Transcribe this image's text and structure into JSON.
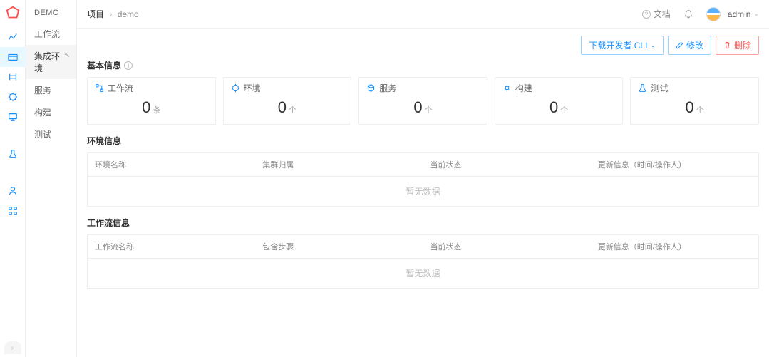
{
  "top": {
    "crumb_root": "项目",
    "crumb_leaf": "demo",
    "doc_label": "文档",
    "user_name": "admin"
  },
  "sidebar": {
    "project_label": "DEMO",
    "items": [
      "工作流",
      "集成环境",
      "服务",
      "构建",
      "测试"
    ],
    "active_index": 1
  },
  "actions": {
    "download_cli": "下载开发者 CLI",
    "edit": "修改",
    "delete": "删除"
  },
  "basic": {
    "title": "基本信息",
    "cards": [
      {
        "label": "工作流",
        "value": "0",
        "unit": "条"
      },
      {
        "label": "环境",
        "value": "0",
        "unit": "个"
      },
      {
        "label": "服务",
        "value": "0",
        "unit": "个"
      },
      {
        "label": "构建",
        "value": "0",
        "unit": "个"
      },
      {
        "label": "测试",
        "value": "0",
        "unit": "个"
      }
    ]
  },
  "env_table": {
    "title": "环境信息",
    "cols": [
      "环境名称",
      "集群归属",
      "当前状态",
      "更新信息（时间/操作人）"
    ],
    "empty": "暂无数据"
  },
  "wf_table": {
    "title": "工作流信息",
    "cols": [
      "工作流名称",
      "包含步骤",
      "当前状态",
      "更新信息（时间/操作人）"
    ],
    "empty": "暂无数据"
  }
}
